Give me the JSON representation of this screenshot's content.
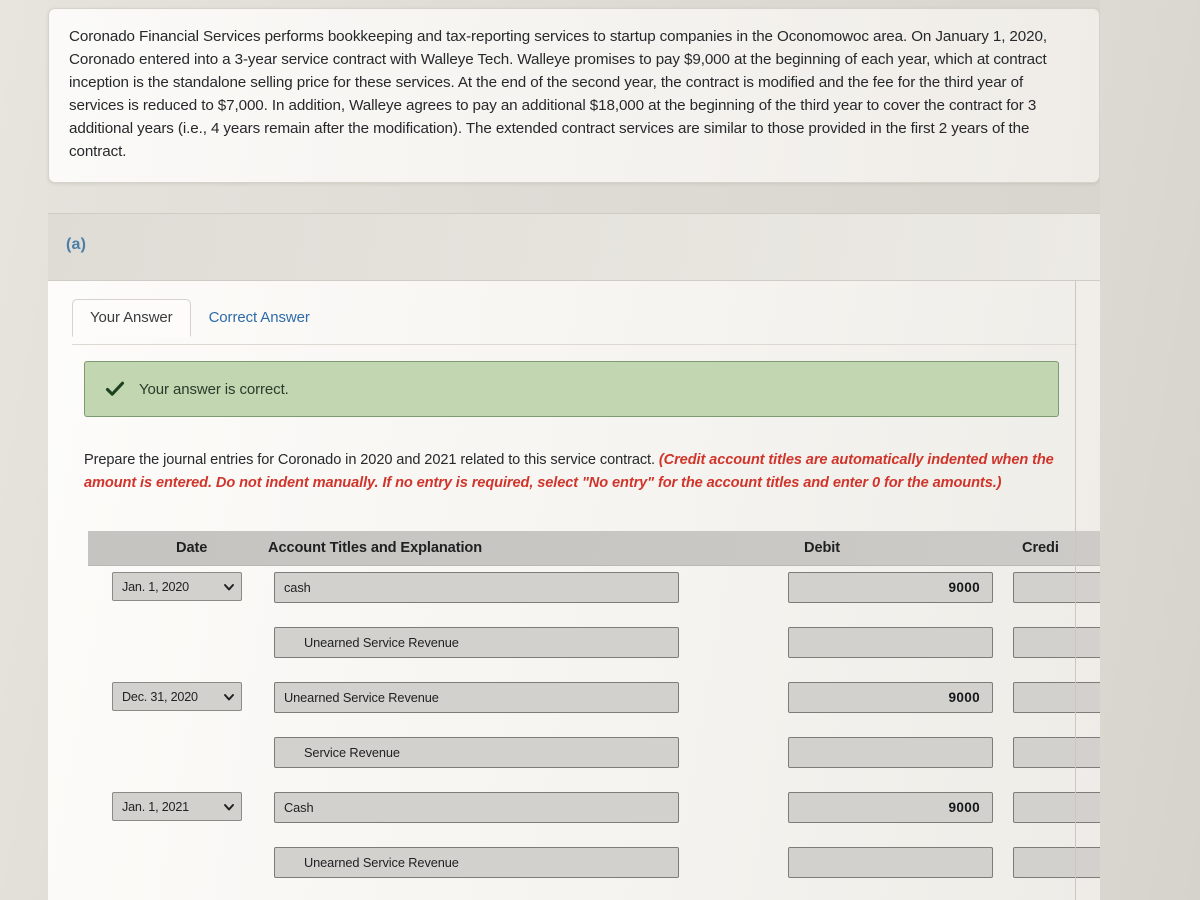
{
  "problem": {
    "text": "Coronado Financial Services performs bookkeeping and tax-reporting services to startup companies in the Oconomowoc area. On January 1, 2020, Coronado entered into a 3-year service contract with Walleye Tech. Walleye promises to pay $9,000 at the beginning of each year, which at contract inception is the standalone selling price for these services. At the end of the second year, the contract is modified and the fee for the third year of services is reduced to $7,000. In addition, Walleye agrees to pay an additional $18,000 at the beginning of the third year to cover the contract for 3 additional years (i.e., 4 years remain after the modification). The extended contract services are similar to those provided in the first 2 years of the contract."
  },
  "part": {
    "label": "(a)"
  },
  "tabs": [
    {
      "label": "Your Answer",
      "active": true
    },
    {
      "label": "Correct Answer",
      "active": false
    }
  ],
  "banner": {
    "icon": "check-icon",
    "text": "Your answer is correct.",
    "background_color": "#c2d6b1",
    "border_color": "#7e9a70",
    "text_color": "#2a3c2b"
  },
  "instructions": {
    "lead": "Prepare the journal entries for Coronado in 2020 and 2021 related to this service contract. ",
    "note": "(Credit account titles are automatically indented when the amount is entered. Do not indent manually. If no entry is required, select \"No entry\" for the account titles and enter 0 for the amounts.)",
    "note_color": "#d0352c"
  },
  "table": {
    "headers": {
      "date": "Date",
      "account": "Account Titles and Explanation",
      "debit": "Debit",
      "credit": "Credi"
    },
    "rows": [
      {
        "date": "Jan. 1, 2020",
        "has_date": true,
        "account": "cash",
        "indented": false,
        "debit": "9000",
        "credit": ""
      },
      {
        "date": "",
        "has_date": false,
        "account": "Unearned Service Revenue",
        "indented": true,
        "debit": "",
        "credit": ""
      },
      {
        "date": "Dec. 31, 2020",
        "has_date": true,
        "account": "Unearned Service Revenue",
        "indented": false,
        "debit": "9000",
        "credit": ""
      },
      {
        "date": "",
        "has_date": false,
        "account": "Service Revenue",
        "indented": true,
        "debit": "",
        "credit": ""
      },
      {
        "date": "Jan. 1, 2021",
        "has_date": true,
        "account": "Cash",
        "indented": false,
        "debit": "9000",
        "credit": ""
      },
      {
        "date": "",
        "has_date": false,
        "account": "Unearned Service Revenue",
        "indented": true,
        "debit": "",
        "credit": ""
      }
    ]
  }
}
